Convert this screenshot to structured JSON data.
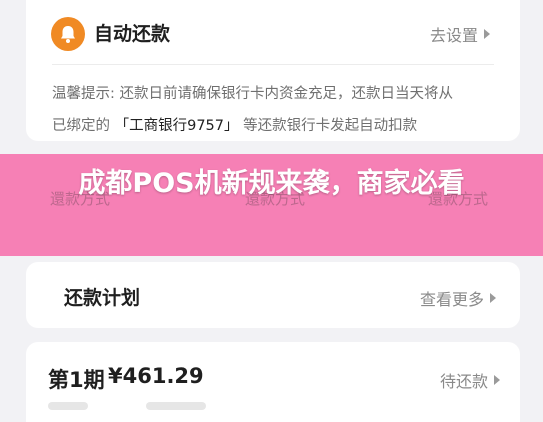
{
  "autopay": {
    "title": "自动还款",
    "setup_link": "去设置",
    "tip_line1": "温馨提示: 还款日前请确保银行卡内资金充足，还款日当天将从",
    "tip_line2_prefix": "已绑定的 ",
    "tip_bank": "「工商银行9757」",
    "tip_line2_suffix": " 等还款银行卡发起自动扣款",
    "icon": "bell-icon"
  },
  "banner": {
    "title": "成都POS机新规来袭，商家必看",
    "ghost_left": "還款方式",
    "ghost_mid": "還款方式",
    "ghost_right": "還款方式"
  },
  "plan": {
    "title": "还款计划",
    "view_more": "查看更多"
  },
  "period": {
    "label": "第1期",
    "amount": "¥461.29",
    "status": "待还款"
  },
  "colors": {
    "accent_orange": "#f08a24",
    "banner_pink": "#f76eaa"
  }
}
